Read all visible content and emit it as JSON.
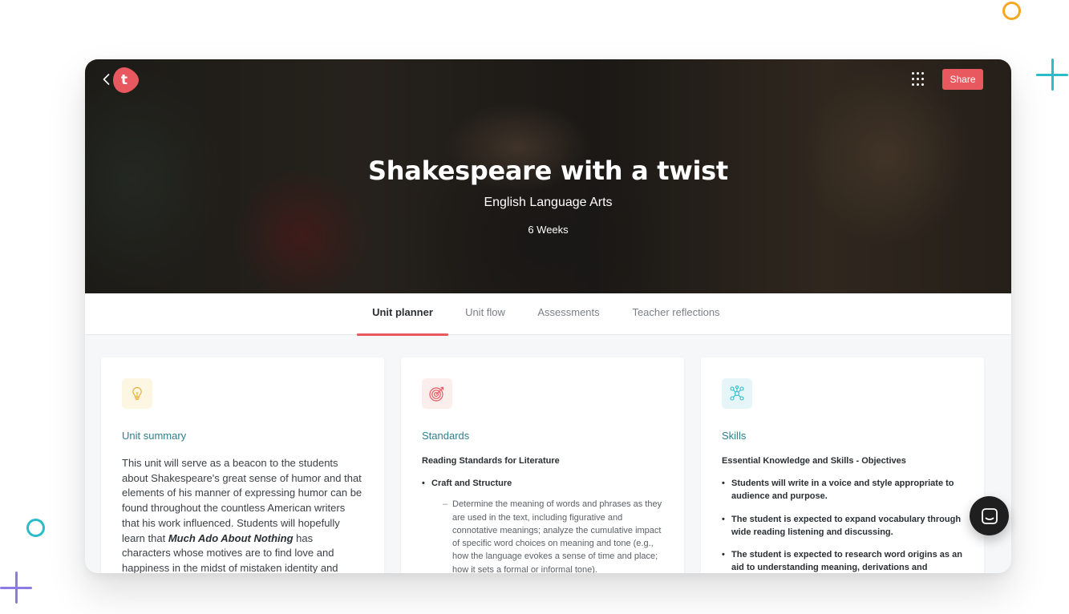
{
  "header": {
    "logo_letter": "t",
    "share_label": "Share",
    "title": "Shakespeare with a twist",
    "subject": "English Language Arts",
    "duration": "6 Weeks"
  },
  "tabs": [
    {
      "label": "Unit planner",
      "active": true
    },
    {
      "label": "Unit flow",
      "active": false
    },
    {
      "label": "Assessments",
      "active": false
    },
    {
      "label": "Teacher reflections",
      "active": false
    }
  ],
  "cards": {
    "summary": {
      "icon": "lightbulb-icon",
      "title": "Unit summary",
      "body_before": "This unit will serve as a beacon to the students about Shakespeare's great sense of humor and that elements of his manner of expressing humor can be found throughout the countless American writers that his work influenced. Students will hopefully learn that ",
      "body_emphasis": "Much Ado About Nothing",
      "body_after": " has characters whose motives are to find love and happiness in the midst of mistaken identity and misconception. This is the book that will be"
    },
    "standards": {
      "icon": "target-icon",
      "title": "Standards",
      "subhead": "Reading Standards for Literature",
      "items": [
        {
          "label": "Craft and Structure",
          "sub": "Determine the meaning of words and phrases as they are used in the text, including figurative and connotative meanings; analyze the cumulative impact of specific word choices on meaning and tone (e.g., how the language evokes a sense of time and place; how it sets a formal or informal tone)."
        }
      ]
    },
    "skills": {
      "icon": "network-icon",
      "title": "Skills",
      "subhead": "Essential Knowledge and Skills - Objectives",
      "items": [
        "Students will write in a voice and style appropriate to audience and purpose.",
        "The student is expected to expand vocabulary through wide reading listening and discussing.",
        "The student is expected to research word origins as an aid to understanding meaning, derivations and spelling."
      ]
    }
  },
  "colors": {
    "accent": "#e8595f",
    "card_title": "#2f7f8e",
    "summary_icon_bg": "#fdf6e3",
    "standards_icon_bg": "#fdeeee",
    "skills_icon_bg": "#e6f6f8"
  }
}
